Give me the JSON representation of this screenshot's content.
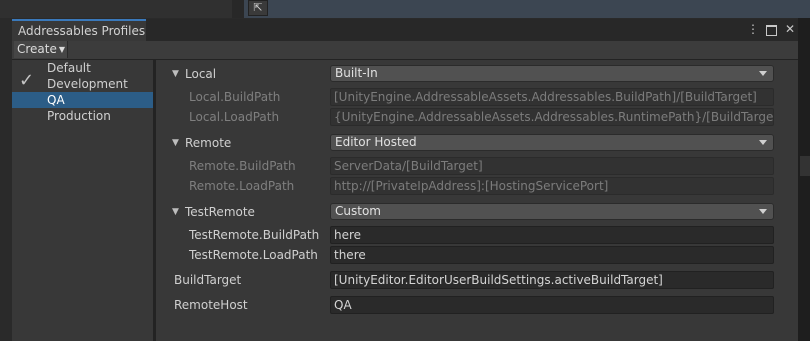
{
  "window": {
    "tab_title": "Addressables Profiles",
    "icons": [
      "kebab-menu-icon",
      "maximize-icon",
      "close-icon"
    ]
  },
  "toolbar": {
    "create_label": "Create"
  },
  "profiles": [
    {
      "name": "Default",
      "selected": false,
      "active": false
    },
    {
      "name": "Development",
      "selected": false,
      "active": true
    },
    {
      "name": "QA",
      "selected": true,
      "active": false
    },
    {
      "name": "Production",
      "selected": false,
      "active": false
    }
  ],
  "groups": {
    "local": {
      "label": "Local",
      "value": "Built-In",
      "build_label": "Local.BuildPath",
      "build_value": "[UnityEngine.AddressableAssets.Addressables.BuildPath]/[BuildTarget]",
      "load_label": "Local.LoadPath",
      "load_value": "{UnityEngine.AddressableAssets.Addressables.RuntimePath}/[BuildTarget]"
    },
    "remote": {
      "label": "Remote",
      "value": "Editor Hosted",
      "build_label": "Remote.BuildPath",
      "build_value": "ServerData/[BuildTarget]",
      "load_label": "Remote.LoadPath",
      "load_value": "http://[PrivateIpAddress]:[HostingServicePort]"
    },
    "test_remote": {
      "label": "TestRemote",
      "value": "Custom",
      "build_label": "TestRemote.BuildPath",
      "build_value": "here",
      "load_label": "TestRemote.LoadPath",
      "load_value": "there"
    }
  },
  "variables": {
    "build_target_label": "BuildTarget",
    "build_target_value": "[UnityEditor.EditorUserBuildSettings.activeBuildTarget]",
    "remote_host_label": "RemoteHost",
    "remote_host_value": "QA"
  },
  "colors": {
    "selection": "#2c5d87",
    "tab_accent": "#3a79bb"
  }
}
